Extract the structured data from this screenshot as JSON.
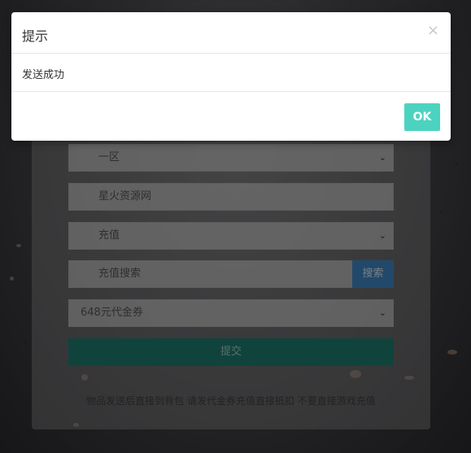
{
  "form": {
    "server_select": {
      "value": "一区"
    },
    "site_input": {
      "value": "星火资源网"
    },
    "type_select": {
      "value": "充值"
    },
    "search": {
      "placeholder": "充值搜索",
      "button_label": "搜索"
    },
    "item_select": {
      "value": "648元代金券"
    },
    "submit_label": "提交",
    "note": "物品发送后直接到背包 请发代金券充值直接抵扣 不要直接游戏充值"
  },
  "dialog": {
    "title": "提示",
    "message": "发送成功",
    "ok_label": "OK",
    "close_glyph": "×"
  },
  "colors": {
    "ok_button": "#4cd3c0",
    "search_button": "#3f86c2",
    "submit_button": "#1e7a6e"
  }
}
